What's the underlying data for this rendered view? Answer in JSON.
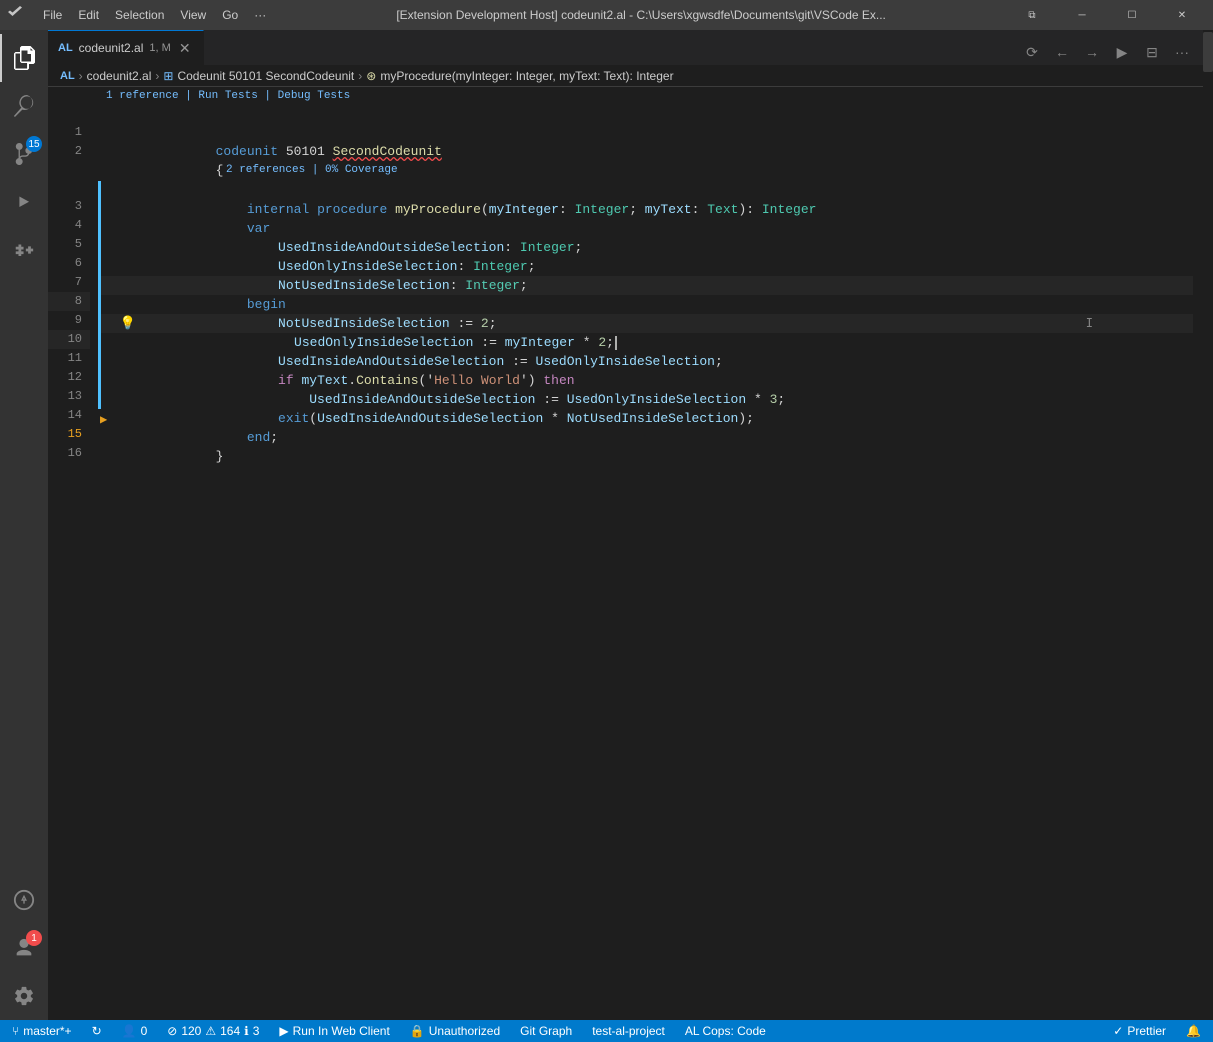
{
  "titlebar": {
    "menu_items": [
      "File",
      "Edit",
      "Selection",
      "View",
      "Go",
      "···"
    ],
    "title": "[Extension Development Host] codeunit2.al - C:\\Users\\xgwsdfe\\Documents\\git\\VSCode Ex...",
    "controls": [
      "⧉",
      "─",
      "☐",
      "✕"
    ]
  },
  "activity_bar": {
    "items": [
      {
        "name": "explorer",
        "icon": "⬜",
        "active": true
      },
      {
        "name": "search",
        "icon": "🔍"
      },
      {
        "name": "source-control",
        "icon": "⑂",
        "badge": "15"
      },
      {
        "name": "run-debug",
        "icon": "▷"
      },
      {
        "name": "extensions",
        "icon": "⊞"
      },
      {
        "name": "al-explorer",
        "icon": "◫"
      },
      {
        "name": "timeline",
        "icon": "⊙"
      },
      {
        "name": "terminal",
        "icon": "⊡"
      }
    ],
    "bottom_items": [
      {
        "name": "alpa",
        "icon": "◐"
      },
      {
        "name": "accounts",
        "icon": "👤",
        "badge_red": "1"
      },
      {
        "name": "settings",
        "icon": "⚙"
      }
    ]
  },
  "editor": {
    "tab": {
      "lang_indicator": "AL",
      "filename": "codeunit2.al",
      "status": "1, M",
      "modified": true
    },
    "breadcrumb": {
      "lang": "AL",
      "file": "codeunit2.al",
      "codeunit": "Codeunit 50101 SecondCodeunit",
      "procedure": "myProcedure(myInteger: Integer, myText: Text): Integer"
    },
    "header_refs": "1 reference | Run Tests | Debug Tests",
    "coverage_refs": "2 references | 0% Coverage",
    "lines": [
      {
        "num": 1,
        "has_blue_bar": false,
        "content": [
          {
            "text": "codeunit",
            "cls": "kw"
          },
          {
            "text": " 50101 ",
            "cls": "punct"
          },
          {
            "text": "SecondCodeunit",
            "cls": "fn wavy"
          }
        ]
      },
      {
        "num": 2,
        "has_blue_bar": false,
        "content": [
          {
            "text": "{",
            "cls": "punct"
          }
        ]
      },
      {
        "num": 3,
        "has_blue_bar": true,
        "content": [
          {
            "text": "    ",
            "cls": ""
          },
          {
            "text": "internal",
            "cls": "kw"
          },
          {
            "text": " ",
            "cls": ""
          },
          {
            "text": "procedure",
            "cls": "kw"
          },
          {
            "text": " ",
            "cls": ""
          },
          {
            "text": "myProcedure",
            "cls": "fn"
          },
          {
            "text": "(",
            "cls": "punct"
          },
          {
            "text": "myInteger",
            "cls": "var"
          },
          {
            "text": ": ",
            "cls": "punct"
          },
          {
            "text": "Integer",
            "cls": "type"
          },
          {
            "text": "; ",
            "cls": "punct"
          },
          {
            "text": "myText",
            "cls": "var"
          },
          {
            "text": ": ",
            "cls": "punct"
          },
          {
            "text": "Text",
            "cls": "type"
          },
          {
            "text": "): ",
            "cls": "punct"
          },
          {
            "text": "Integer",
            "cls": "type"
          }
        ]
      },
      {
        "num": 4,
        "has_blue_bar": true,
        "content": [
          {
            "text": "    ",
            "cls": ""
          },
          {
            "text": "var",
            "cls": "kw"
          }
        ]
      },
      {
        "num": 5,
        "has_blue_bar": true,
        "content": [
          {
            "text": "        ",
            "cls": ""
          },
          {
            "text": "UsedInsideAndOutsideSelection",
            "cls": "var"
          },
          {
            "text": ": ",
            "cls": "punct"
          },
          {
            "text": "Integer",
            "cls": "type"
          },
          {
            "text": ";",
            "cls": "punct"
          }
        ]
      },
      {
        "num": 6,
        "has_blue_bar": true,
        "content": [
          {
            "text": "        ",
            "cls": ""
          },
          {
            "text": "UsedOnlyInsideSelection",
            "cls": "var"
          },
          {
            "text": ": ",
            "cls": "punct"
          },
          {
            "text": "Integer",
            "cls": "type"
          },
          {
            "text": ";",
            "cls": "punct"
          }
        ]
      },
      {
        "num": 7,
        "has_blue_bar": true,
        "content": [
          {
            "text": "        ",
            "cls": ""
          },
          {
            "text": "NotUsedInsideSelection",
            "cls": "var"
          },
          {
            "text": ": ",
            "cls": "punct"
          },
          {
            "text": "Integer",
            "cls": "type"
          },
          {
            "text": ";",
            "cls": "punct"
          }
        ]
      },
      {
        "num": 8,
        "has_blue_bar": true,
        "is_current": true,
        "content": [
          {
            "text": "    ",
            "cls": ""
          },
          {
            "text": "begin",
            "cls": "kw"
          }
        ]
      },
      {
        "num": 9,
        "has_blue_bar": true,
        "content": [
          {
            "text": "        ",
            "cls": ""
          },
          {
            "text": "NotUsedInsideSelection",
            "cls": "var"
          },
          {
            "text": " := ",
            "cls": "punct"
          },
          {
            "text": "2",
            "cls": "num"
          },
          {
            "text": ";",
            "cls": "punct"
          }
        ]
      },
      {
        "num": 10,
        "has_blue_bar": true,
        "has_lightbulb": true,
        "is_current": true,
        "content": [
          {
            "text": "        ",
            "cls": ""
          },
          {
            "text": "UsedOnlyInsideSelection",
            "cls": "var"
          },
          {
            "text": " := ",
            "cls": "punct"
          },
          {
            "text": "myInteger",
            "cls": "var"
          },
          {
            "text": " * ",
            "cls": "punct"
          },
          {
            "text": "2",
            "cls": "num"
          },
          {
            "text": ";",
            "cls": "punct"
          },
          {
            "text": "|",
            "cls": "cursor"
          }
        ]
      },
      {
        "num": 11,
        "has_blue_bar": true,
        "content": [
          {
            "text": "        ",
            "cls": ""
          },
          {
            "text": "UsedInsideAndOutsideSelection",
            "cls": "var"
          },
          {
            "text": " := ",
            "cls": "punct"
          },
          {
            "text": "UsedOnlyInsideSelection",
            "cls": "var"
          },
          {
            "text": ";",
            "cls": "punct"
          }
        ]
      },
      {
        "num": 12,
        "has_blue_bar": true,
        "content": [
          {
            "text": "        ",
            "cls": ""
          },
          {
            "text": "if",
            "cls": "kw-ctrl"
          },
          {
            "text": " ",
            "cls": ""
          },
          {
            "text": "myText",
            "cls": "var"
          },
          {
            "text": ".",
            "cls": "punct"
          },
          {
            "text": "Contains",
            "cls": "fn"
          },
          {
            "text": "('",
            "cls": "punct"
          },
          {
            "text": "Hello World",
            "cls": "str"
          },
          {
            "text": "') ",
            "cls": "punct"
          },
          {
            "text": "then",
            "cls": "kw-ctrl"
          }
        ]
      },
      {
        "num": 13,
        "has_blue_bar": true,
        "content": [
          {
            "text": "            ",
            "cls": ""
          },
          {
            "text": "UsedInsideAndOutsideSelection",
            "cls": "var"
          },
          {
            "text": " := ",
            "cls": "punct"
          },
          {
            "text": "UsedOnlyInsideSelection",
            "cls": "var"
          },
          {
            "text": " * ",
            "cls": "punct"
          },
          {
            "text": "3",
            "cls": "num"
          },
          {
            "text": ";",
            "cls": "punct"
          }
        ]
      },
      {
        "num": 14,
        "has_blue_bar": true,
        "content": [
          {
            "text": "        ",
            "cls": ""
          },
          {
            "text": "exit",
            "cls": "kw"
          },
          {
            "text": "(",
            "cls": "punct"
          },
          {
            "text": "UsedInsideAndOutsideSelection",
            "cls": "var"
          },
          {
            "text": " * ",
            "cls": "punct"
          },
          {
            "text": "NotUsedInsideSelection",
            "cls": "var"
          },
          {
            "text": ");",
            "cls": "punct"
          }
        ]
      },
      {
        "num": 15,
        "has_orange_arrow": true,
        "content": [
          {
            "text": "    ",
            "cls": ""
          },
          {
            "text": "end",
            "cls": "kw"
          },
          {
            "text": ";",
            "cls": "punct"
          }
        ]
      },
      {
        "num": 16,
        "has_blue_bar": false,
        "content": [
          {
            "text": "}",
            "cls": "punct"
          }
        ]
      }
    ]
  },
  "statusbar": {
    "branch": "master*+",
    "sync": "",
    "errors": "0",
    "warnings": "120",
    "info": "164",
    "hints": "3",
    "run_in_web": "Run In Web Client",
    "unauthorized": "Unauthorized",
    "git_graph": "Git Graph",
    "project": "test-al-project",
    "al_cops": "AL Cops: Code",
    "prettier": "Prettier"
  }
}
